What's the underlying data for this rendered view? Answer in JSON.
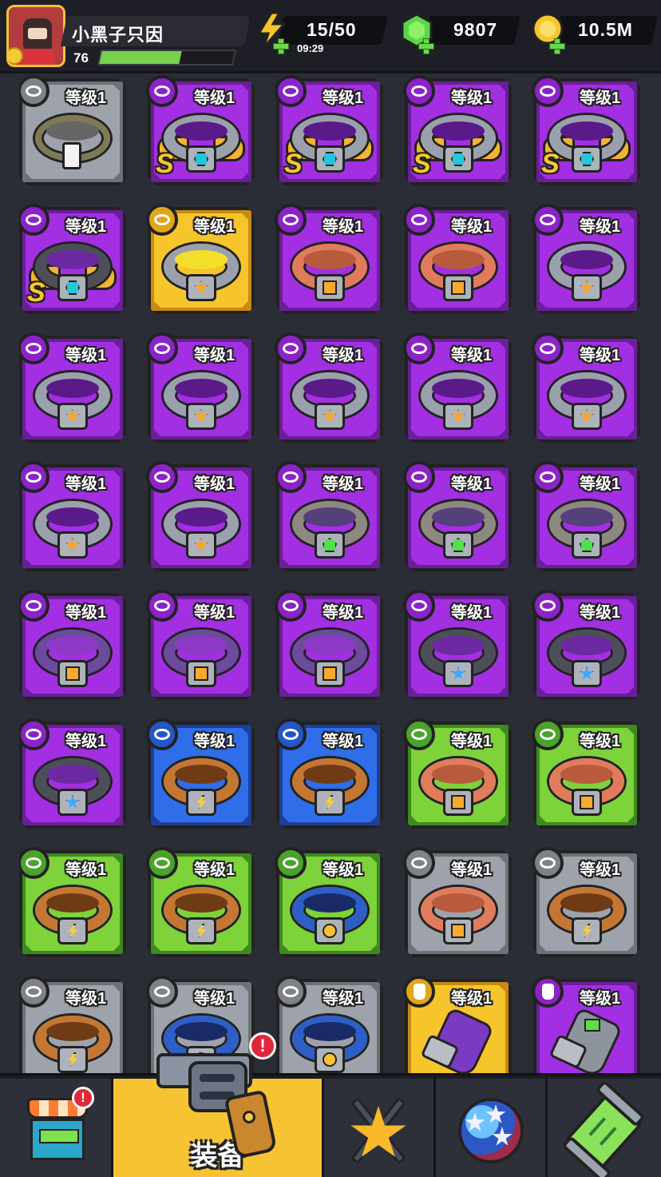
{
  "player": {
    "name": "小黑子只因",
    "level": "76",
    "xp_fraction": 0.6
  },
  "resources": {
    "energy": {
      "value": "15/50",
      "timer": "09:29",
      "icon": "lightning-bolt-icon"
    },
    "gems": {
      "value": "9807",
      "icon": "green-gem-icon"
    },
    "gold": {
      "value": "10.5M",
      "icon": "gold-coin-icon"
    }
  },
  "colors": {
    "grey": "#9ea2aa",
    "purple": "#a32fe3",
    "blue": "#2f6ee8",
    "green": "#7ed23a",
    "yellow": "#f6c52c",
    "gold_text": "#f7c82c"
  },
  "inventory": [
    {
      "level": "等级1",
      "rarity": "grey",
      "type": "collar",
      "band": "olive",
      "gem": "tag"
    },
    {
      "level": "等级1",
      "rarity": "purple",
      "type": "collar",
      "band": "silver",
      "gem": "hex",
      "wings": true,
      "s": "S"
    },
    {
      "level": "等级1",
      "rarity": "purple",
      "type": "collar",
      "band": "silver",
      "gem": "hex",
      "wings": true,
      "s": "S"
    },
    {
      "level": "等级1",
      "rarity": "purple",
      "type": "collar",
      "band": "silver",
      "gem": "hex",
      "wings": true,
      "s": "S"
    },
    {
      "level": "等级1",
      "rarity": "purple",
      "type": "collar",
      "band": "silver",
      "gem": "hex",
      "wings": true,
      "s": "S"
    },
    {
      "level": "等级1",
      "rarity": "purple",
      "type": "collar",
      "band": "dark",
      "gem": "hex",
      "wings": true,
      "s": "S"
    },
    {
      "level": "等级1",
      "rarity": "yellow",
      "type": "collar",
      "band": "yellowin",
      "gem": "star"
    },
    {
      "level": "等级1",
      "rarity": "purple",
      "type": "collar",
      "band": "rope",
      "gem": "stripe"
    },
    {
      "level": "等级1",
      "rarity": "purple",
      "type": "collar",
      "band": "rope",
      "gem": "stripe"
    },
    {
      "level": "等级1",
      "rarity": "purple",
      "type": "collar",
      "band": "silver",
      "gem": "star"
    },
    {
      "level": "等级1",
      "rarity": "purple",
      "type": "collar",
      "band": "silver",
      "gem": "star"
    },
    {
      "level": "等级1",
      "rarity": "purple",
      "type": "collar",
      "band": "silver",
      "gem": "star"
    },
    {
      "level": "等级1",
      "rarity": "purple",
      "type": "collar",
      "band": "silver",
      "gem": "star"
    },
    {
      "level": "等级1",
      "rarity": "purple",
      "type": "collar",
      "band": "silver",
      "gem": "star"
    },
    {
      "level": "等级1",
      "rarity": "purple",
      "type": "collar",
      "band": "silver",
      "gem": "star"
    },
    {
      "level": "等级1",
      "rarity": "purple",
      "type": "collar",
      "band": "silver",
      "gem": "star"
    },
    {
      "level": "等级1",
      "rarity": "purple",
      "type": "collar",
      "band": "silver",
      "gem": "star"
    },
    {
      "level": "等级1",
      "rarity": "purple",
      "type": "collar",
      "band": "stone",
      "gem": "green"
    },
    {
      "level": "等级1",
      "rarity": "purple",
      "type": "collar",
      "band": "stone",
      "gem": "green"
    },
    {
      "level": "等级1",
      "rarity": "purple",
      "type": "collar",
      "band": "stone",
      "gem": "green"
    },
    {
      "level": "等级1",
      "rarity": "purple",
      "type": "collar",
      "band": "violet",
      "gem": "stripe"
    },
    {
      "level": "等级1",
      "rarity": "purple",
      "type": "collar",
      "band": "violet",
      "gem": "stripe"
    },
    {
      "level": "等级1",
      "rarity": "purple",
      "type": "collar",
      "band": "violet",
      "gem": "stripe"
    },
    {
      "level": "等级1",
      "rarity": "purple",
      "type": "collar",
      "band": "dark",
      "gem": "bluestar"
    },
    {
      "level": "等级1",
      "rarity": "purple",
      "type": "collar",
      "band": "dark",
      "gem": "bluestar"
    },
    {
      "level": "等级1",
      "rarity": "purple",
      "type": "collar",
      "band": "dark",
      "gem": "bluestar"
    },
    {
      "level": "等级1",
      "rarity": "blue",
      "type": "collar",
      "band": "leather",
      "gem": "bolt"
    },
    {
      "level": "等级1",
      "rarity": "blue",
      "type": "collar",
      "band": "leather",
      "gem": "bolt"
    },
    {
      "level": "等级1",
      "rarity": "green",
      "type": "collar",
      "band": "rope",
      "gem": "stripe"
    },
    {
      "level": "等级1",
      "rarity": "green",
      "type": "collar",
      "band": "rope",
      "gem": "stripe"
    },
    {
      "level": "等级1",
      "rarity": "green",
      "type": "collar",
      "band": "leather",
      "gem": "bolt"
    },
    {
      "level": "等级1",
      "rarity": "green",
      "type": "collar",
      "band": "leather",
      "gem": "bolt"
    },
    {
      "level": "等级1",
      "rarity": "green",
      "type": "collar",
      "band": "blue",
      "gem": "orb"
    },
    {
      "level": "等级1",
      "rarity": "grey",
      "type": "collar",
      "band": "rope",
      "gem": "stripe"
    },
    {
      "level": "等级1",
      "rarity": "grey",
      "type": "collar",
      "band": "leather",
      "gem": "bolt"
    },
    {
      "level": "等级1",
      "rarity": "grey",
      "type": "collar",
      "band": "leather",
      "gem": "bolt"
    },
    {
      "level": "等级1",
      "rarity": "grey",
      "type": "collar",
      "band": "blue",
      "gem": "orb"
    },
    {
      "level": "等级1",
      "rarity": "grey",
      "type": "collar",
      "band": "blue",
      "gem": "orb"
    },
    {
      "level": "等级1",
      "rarity": "yellow",
      "type": "glove",
      "hand": "purple"
    },
    {
      "level": "等级1",
      "rarity": "purple",
      "type": "glove",
      "hand": "steel"
    }
  ],
  "bottom_nav": {
    "shop": {
      "icon": "shop-stall-icon",
      "notification": "!"
    },
    "equipment": {
      "label": "装备",
      "icon": "revolver-icon",
      "notification": "!",
      "active": true
    },
    "battle": {
      "icon": "crossed-swords-star-icon"
    },
    "talent": {
      "icon": "star-orb-icon"
    },
    "gene": {
      "icon": "gene-tube-icon"
    }
  }
}
